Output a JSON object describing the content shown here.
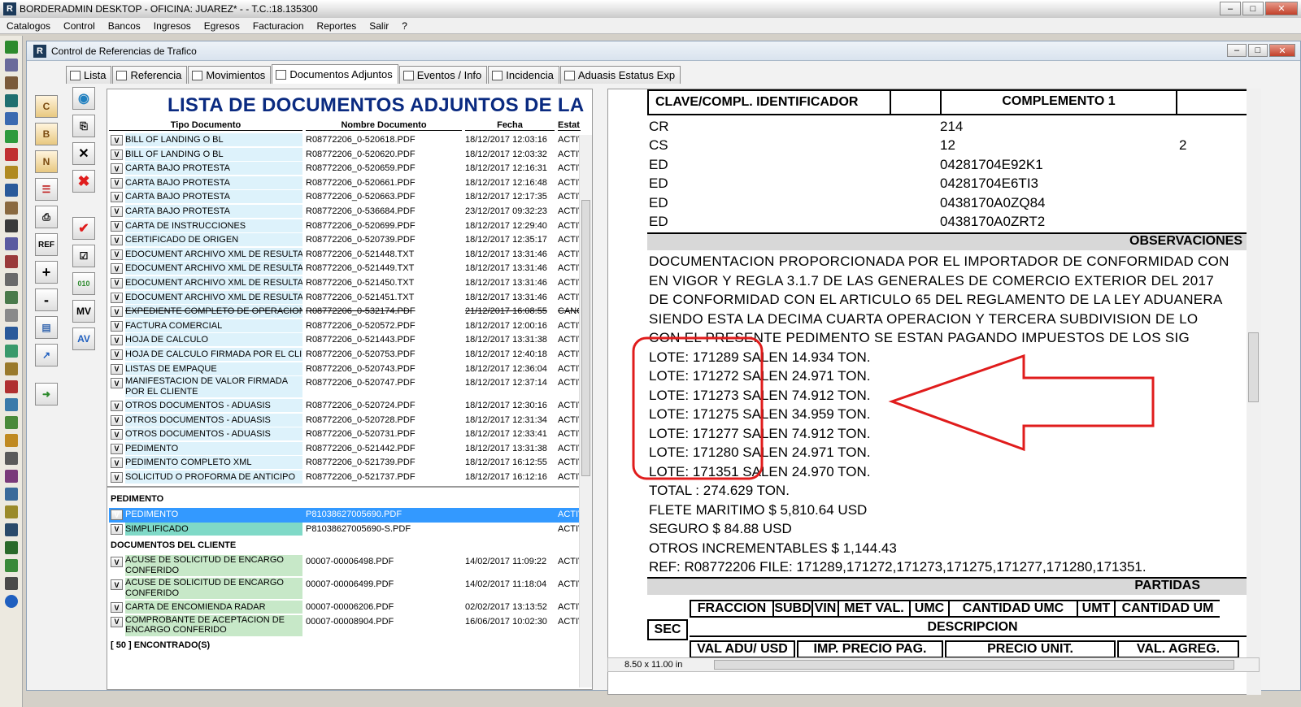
{
  "window": {
    "title": "BORDERADMIN DESKTOP - OFICINA: JUAREZ* -  - T.C.:18.135300"
  },
  "menu": [
    "Catalogos",
    "Control",
    "Bancos",
    "Ingresos",
    "Egresos",
    "Facturacion",
    "Reportes",
    "Salir",
    "?"
  ],
  "child": {
    "title": "Control de Referencias de Trafico"
  },
  "tabs": [
    "Lista",
    "Referencia",
    "Movimientos",
    "Documentos Adjuntos",
    "Eventos / Info",
    "Incidencia",
    "Aduasis Estatus Exp"
  ],
  "active_tab": "Documentos Adjuntos",
  "doclist": {
    "heading": "LISTA DE DOCUMENTOS ADJUNTOS DE LA",
    "columns": {
      "tipo": "Tipo Documento",
      "nombre": "Nombre Documento",
      "fecha": "Fecha",
      "estatus": "Estat"
    },
    "rows": [
      {
        "t": "BILL OF LANDING O BL",
        "n": "R08772206_0-520618.PDF",
        "f": "18/12/2017 12:03:16",
        "s": "ACTIVO"
      },
      {
        "t": "BILL OF LANDING O BL",
        "n": "R08772206_0-520620.PDF",
        "f": "18/12/2017 12:03:32",
        "s": "ACTIVO"
      },
      {
        "t": "CARTA BAJO PROTESTA",
        "n": "R08772206_0-520659.PDF",
        "f": "18/12/2017 12:16:31",
        "s": "ACTIVO"
      },
      {
        "t": "CARTA BAJO PROTESTA",
        "n": "R08772206_0-520661.PDF",
        "f": "18/12/2017 12:16:48",
        "s": "ACTIVO"
      },
      {
        "t": "CARTA BAJO PROTESTA",
        "n": "R08772206_0-520663.PDF",
        "f": "18/12/2017 12:17:35",
        "s": "ACTIVO"
      },
      {
        "t": "CARTA BAJO PROTESTA",
        "n": "R08772206_0-536684.PDF",
        "f": "23/12/2017 09:32:23",
        "s": "ACTIVO"
      },
      {
        "t": "CARTA DE INSTRUCCIONES",
        "n": "R08772206_0-520699.PDF",
        "f": "18/12/2017 12:29:40",
        "s": "ACTIVO"
      },
      {
        "t": "CERTIFICADO DE ORIGEN",
        "n": "R08772206_0-520739.PDF",
        "f": "18/12/2017 12:35:17",
        "s": "ACTIVO"
      },
      {
        "t": "EDOCUMENT ARCHIVO XML DE RESULTADO",
        "n": "R08772206_0-521448.TXT",
        "f": "18/12/2017 13:31:46",
        "s": "ACTIVO"
      },
      {
        "t": "EDOCUMENT ARCHIVO XML DE RESULTADO",
        "n": "R08772206_0-521449.TXT",
        "f": "18/12/2017 13:31:46",
        "s": "ACTIVO"
      },
      {
        "t": "EDOCUMENT ARCHIVO XML DE RESULTADO",
        "n": "R08772206_0-521450.TXT",
        "f": "18/12/2017 13:31:46",
        "s": "ACTIVO"
      },
      {
        "t": "EDOCUMENT ARCHIVO XML DE RESULTADO",
        "n": "R08772206_0-521451.TXT",
        "f": "18/12/2017 13:31:46",
        "s": "ACTIVO"
      },
      {
        "t": "EXPEDIENTE COMPLETO DE OPERACION",
        "n": "R08772206_0-532174.PDF",
        "f": "21/12/2017 16:08:55",
        "s": "CANCELADO",
        "strike": true
      },
      {
        "t": "FACTURA COMERCIAL",
        "n": "R08772206_0-520572.PDF",
        "f": "18/12/2017 12:00:16",
        "s": "ACTIVO"
      },
      {
        "t": "HOJA DE CALCULO",
        "n": "R08772206_0-521443.PDF",
        "f": "18/12/2017 13:31:38",
        "s": "ACTIVO"
      },
      {
        "t": "HOJA DE CALCULO FIRMADA POR EL CLIENTE",
        "n": "R08772206_0-520753.PDF",
        "f": "18/12/2017 12:40:18",
        "s": "ACTIVO"
      },
      {
        "t": "LISTAS DE EMPAQUE",
        "n": "R08772206_0-520743.PDF",
        "f": "18/12/2017 12:36:04",
        "s": "ACTIVO"
      },
      {
        "t": "MANIFESTACION DE VALOR FIRMADA POR EL CLIENTE",
        "n": "R08772206_0-520747.PDF",
        "f": "18/12/2017 12:37:14",
        "s": "ACTIVO",
        "tall": true
      },
      {
        "t": "OTROS DOCUMENTOS - ADUASIS",
        "n": "R08772206_0-520724.PDF",
        "f": "18/12/2017 12:30:16",
        "s": "ACTIVO"
      },
      {
        "t": "OTROS DOCUMENTOS - ADUASIS",
        "n": "R08772206_0-520728.PDF",
        "f": "18/12/2017 12:31:34",
        "s": "ACTIVO"
      },
      {
        "t": "OTROS DOCUMENTOS - ADUASIS",
        "n": "R08772206_0-520731.PDF",
        "f": "18/12/2017 12:33:41",
        "s": "ACTIVO"
      },
      {
        "t": "PEDIMENTO",
        "n": "R08772206_0-521442.PDF",
        "f": "18/12/2017 13:31:38",
        "s": "ACTIVO"
      },
      {
        "t": "PEDIMENTO COMPLETO XML",
        "n": "R08772206_0-521739.PDF",
        "f": "18/12/2017 16:12:55",
        "s": "ACTIVO"
      },
      {
        "t": "SOLICITUD O PROFORMA DE ANTICIPO",
        "n": "R08772206_0-521737.PDF",
        "f": "18/12/2017 16:12:16",
        "s": "ACTIVO"
      }
    ],
    "pedimento_section": "PEDIMENTO",
    "pedimento_rows": [
      {
        "t": "PEDIMENTO",
        "n": "P81038627005690.PDF",
        "f": "",
        "s": "ACTIVO",
        "style": "sel"
      },
      {
        "t": "SIMPLIFICADO",
        "n": "P81038627005690-S.PDF",
        "f": "",
        "s": "ACTIVO",
        "style": "teal"
      }
    ],
    "cliente_section": "DOCUMENTOS DEL CLIENTE",
    "cliente_rows": [
      {
        "t": "ACUSE DE SOLICITUD DE ENCARGO CONFERIDO",
        "n": "00007-00006498.PDF",
        "f": "14/02/2017 11:09:22",
        "s": "ACTIVO",
        "tall": true,
        "style": "green"
      },
      {
        "t": "ACUSE DE SOLICITUD DE ENCARGO CONFERIDO",
        "n": "00007-00006499.PDF",
        "f": "14/02/2017 11:18:04",
        "s": "ACTIVO",
        "tall": true,
        "style": "green"
      },
      {
        "t": "CARTA DE  ENCOMIENDA RADAR",
        "n": "00007-00006206.PDF",
        "f": "02/02/2017 13:13:52",
        "s": "ACTIVO",
        "style": "green"
      },
      {
        "t": "COMPROBANTE DE ACEPTACION DE ENCARGO CONFERIDO",
        "n": "00007-00008904.PDF",
        "f": "16/06/2017 10:02:30",
        "s": "ACTIVO",
        "tall": true,
        "style": "green"
      }
    ],
    "count": "[ 50 ] ENCONTRADO(S)"
  },
  "preview": {
    "clave_header": "CLAVE/COMPL. IDENTIFICADOR",
    "complemento_header": "COMPLEMENTO 1",
    "identifiers": [
      {
        "clave": "CR",
        "c1": "214",
        "c2": ""
      },
      {
        "clave": "CS",
        "c1": "12",
        "c2": "2"
      },
      {
        "clave": "ED",
        "c1": "04281704E92K1",
        "c2": ""
      },
      {
        "clave": "ED",
        "c1": "04281704E6TI3",
        "c2": ""
      },
      {
        "clave": "ED",
        "c1": "0438170A0ZQ84",
        "c2": ""
      },
      {
        "clave": "ED",
        "c1": "0438170A0ZRT2",
        "c2": ""
      }
    ],
    "observaciones_header": "OBSERVACIONES",
    "observaciones": [
      "DOCUMENTACION PROPORCIONADA POR EL IMPORTADOR DE CONFORMIDAD CON",
      "EN  VIGOR Y  REGLA 3.1.7 DE LAS GENERALES DE COMERCIO EXTERIOR DEL 2017",
      "DE CONFORMIDAD CON EL ARTICULO 65 DEL REGLAMENTO DE LA LEY ADUANERA",
      "SIENDO  ESTA  LA  DECIMA CUARTA OPERACION  Y  TERCERA SUBDIVISION  DE LO",
      "CON  EL  PRESENTE  PEDIMENTO  SE ESTAN  PAGANDO  IMPUESTOS  DE LOS  SIG",
      "LOTE: 171289 SALEN 14.934 TON.",
      "LOTE: 171272 SALEN 24.971 TON.",
      "LOTE: 171273 SALEN 74.912 TON.",
      "LOTE: 171275 SALEN 34.959 TON.",
      "LOTE: 171277 SALEN 74.912 TON.",
      "LOTE: 171280 SALEN 24.971 TON.",
      "LOTE: 171351 SALEN 24.970 TON.",
      "TOTAL : 274.629 TON.",
      "FLETE MARITIMO $ 5,810.64 USD",
      "SEGURO $ 84.88 USD",
      "OTROS  INCREMENTABLES $ 1,144.43",
      "REF: R08772206 FILE: 171289,171272,171273,171275,171277,171280,171351."
    ],
    "partidas_header": "PARTIDAS",
    "partidas_cols1": [
      "FRACCION",
      "SUBD",
      "VIN",
      "MET VAL.",
      "UMC",
      "CANTIDAD UMC",
      "UMT",
      "CANTIDAD UM"
    ],
    "sec_label": "SEC",
    "descripcion_label": "DESCRIPCION",
    "partidas_cols2": [
      "VAL ADU/ USD",
      "IMP. PRECIO PAG.",
      "PRECIO UNIT.",
      "VAL. AGREG."
    ],
    "page_size": "8.50 x 11.00 in"
  },
  "sidebar_buttons": {
    "ref": "REF",
    "plus": "+",
    "minus": "-",
    "mv": "MV",
    "av": "AV",
    "c": "C",
    "b": "B",
    "n": "N"
  },
  "colors": {
    "heading": "#0a2a80",
    "annotation": "#e01c1c",
    "selection": "#3399ff",
    "row_tint": "#ddf2fb",
    "green_tint": "#c7e8c8"
  }
}
